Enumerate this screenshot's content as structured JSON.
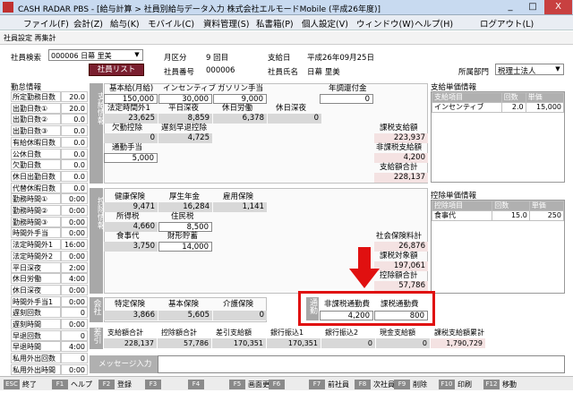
{
  "window": {
    "title": "CASH RADAR PBS - [給与計算 > 社員別給与データ入力 株式会社エルモードMobile (平成26年度)]",
    "min": "_",
    "max": "□",
    "close": "X",
    "icon_text": "CR"
  },
  "menu": [
    "ファイル(F)",
    "会計(Z)",
    "給与(K)",
    "モバイル(C)",
    "資料管理(S)",
    "私書箱(P)",
    "個人設定(V)",
    "ウィンドウ(W)",
    "ヘルプ(H)",
    "ログアウト(L)"
  ],
  "breadcrumb": "社員設定 再集計",
  "header": {
    "search_label": "社員検索",
    "employee_select": "000006 日幕 里美",
    "list_button": "社員リスト",
    "period_label": "月区分",
    "period_value": "9 回目",
    "payday_label": "支給日",
    "payday_value": "平成26年09月25日",
    "empno_label": "社員番号",
    "empno_value": "000006",
    "empname_label": "社員氏名",
    "empname_value": "日幕 里美",
    "dept_label": "所属部門",
    "dept_value": "税理士法人"
  },
  "attendance": {
    "title": "勤怠情報",
    "rows": [
      [
        "所定勤務日数",
        "20.0"
      ],
      [
        "出勤日数①",
        "20.0"
      ],
      [
        "出勤日数②",
        "0.0"
      ],
      [
        "出勤日数③",
        "0.0"
      ],
      [
        "有給休暇日数",
        "0.0"
      ],
      [
        "公休日数",
        "0.0"
      ],
      [
        "欠勤日数",
        "0.0"
      ],
      [
        "休日出勤日数",
        "0.0"
      ],
      [
        "代替休暇日数",
        "0.0"
      ],
      [
        "勤務時間①",
        "0:00"
      ],
      [
        "勤務時間②",
        "0:00"
      ],
      [
        "勤務時間③",
        "0:00"
      ],
      [
        "時間外手当",
        "0:00"
      ],
      [
        "法定時間外1",
        "16:00"
      ],
      [
        "法定時間外2",
        "0:00"
      ],
      [
        "平日深夜",
        "2:00"
      ],
      [
        "休日労働",
        "4:00"
      ],
      [
        "休日深夜",
        "0:00"
      ],
      [
        "時間外手当1",
        "0:00"
      ],
      [
        "遅刻回数",
        "0"
      ],
      [
        "遅刻時間",
        "0:00"
      ],
      [
        "早退回数",
        "0"
      ],
      [
        "早退時間",
        "4:00"
      ],
      [
        "私用外出回数",
        "0"
      ],
      [
        "私用外出時間",
        "0:00"
      ]
    ]
  },
  "payment": {
    "side": "支給情報",
    "row1_labels": [
      "基本給(月給)",
      "インセンティブ",
      "ガソリン手当"
    ],
    "row1_values": [
      "150,000",
      "30,000",
      "9,000"
    ],
    "year_adjust_label": "年調還付金",
    "year_adjust_value": "0",
    "row2_labels": [
      "法定時間外1",
      "平日深夜",
      "休日労働",
      "休日深夜"
    ],
    "row2_values": [
      "23,625",
      "8,859",
      "6,378",
      "0"
    ],
    "row3_labels": [
      "欠勤控除",
      "遅刻早退控除"
    ],
    "row3_values": [
      "0",
      "4,725"
    ],
    "row4_labels": [
      "通勤手当"
    ],
    "row4_values": [
      "5,000"
    ],
    "totals": [
      [
        "課税支給額",
        "223,937"
      ],
      [
        "非課税支給額",
        "4,200"
      ],
      [
        "支給額合計",
        "228,137"
      ]
    ]
  },
  "deduction": {
    "side": "控除情報",
    "row1_labels": [
      "健康保険",
      "厚生年金",
      "雇用保険"
    ],
    "row1_values": [
      "9,471",
      "16,284",
      "1,141"
    ],
    "row2_labels": [
      "所得税",
      "住民税"
    ],
    "row2_values": [
      "4,660",
      "8,500"
    ],
    "row3_labels": [
      "食事代",
      "財形貯蓄"
    ],
    "row3_values": [
      "3,750",
      "14,000"
    ],
    "totals": [
      [
        "社会保険料計",
        "26,876"
      ],
      [
        "課税対象額",
        "197,061"
      ],
      [
        "控除額合計",
        "57,786"
      ]
    ]
  },
  "payunit": {
    "title": "支給単価情報",
    "headers": [
      "支給項目",
      "回数",
      "単価"
    ],
    "rows": [
      [
        "インセンティブ",
        "2.0",
        "15,000"
      ]
    ]
  },
  "dedunit": {
    "title": "控除単価情報",
    "headers": [
      "控除項目",
      "回数",
      "単価"
    ],
    "rows": [
      [
        "食事代",
        "15.0",
        "250"
      ]
    ]
  },
  "employer": {
    "side": "会社",
    "labels": [
      "特定保険",
      "基本保険",
      "介護保険"
    ],
    "values": [
      "3,866",
      "5,605",
      "0"
    ]
  },
  "commute": {
    "side": "通勤",
    "labels": [
      "非課税通勤費",
      "課税通勤費"
    ],
    "values": [
      "4,200",
      "800"
    ]
  },
  "summary": {
    "side": "差引",
    "labels": [
      "支給額合計",
      "控除額合計",
      "差引支給額",
      "銀行振込1",
      "銀行振込2",
      "現金支給額",
      "課税支給額累計"
    ],
    "values": [
      "228,137",
      "57,786",
      "170,351",
      "170,351",
      "0",
      "0",
      "1,790,729"
    ]
  },
  "message": {
    "label": "メッセージ入力"
  },
  "fkeys": [
    [
      "ESC",
      "終了"
    ],
    [
      "F1",
      "ヘルプ"
    ],
    [
      "F2",
      "登録"
    ],
    [
      "F3",
      ""
    ],
    [
      "F4",
      ""
    ],
    [
      "F5",
      "画面更新"
    ],
    [
      "F6",
      ""
    ],
    [
      "F7",
      "前社員"
    ],
    [
      "F8",
      "次社員"
    ],
    [
      "F9",
      "削除"
    ],
    [
      "F10",
      "印刷"
    ],
    [
      "F12",
      "移動"
    ]
  ],
  "annotation": {
    "color": "#e01010",
    "arrow": "arrow-down-icon"
  }
}
